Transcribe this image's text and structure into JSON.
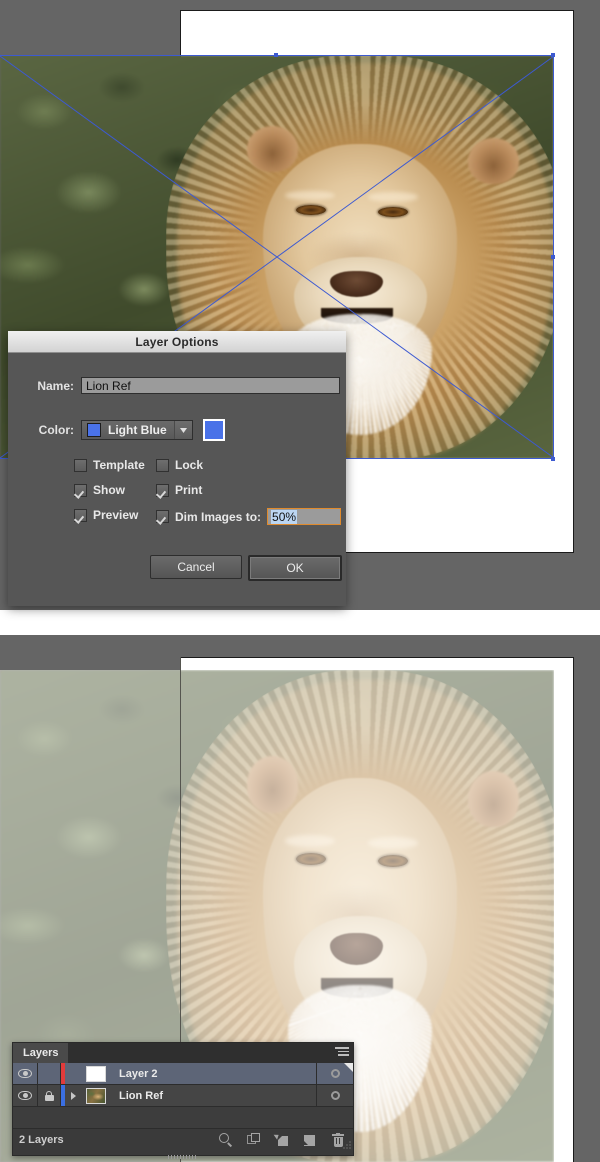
{
  "app": {
    "scene_description": "Adobe Illustrator Layer Options dialog and Layers panel over a lion reference photo"
  },
  "dialog": {
    "title": "Layer Options",
    "name_label": "Name:",
    "name_value": "Lion Ref",
    "color_label": "Color:",
    "color_name": "Light Blue",
    "color_hex": "#4a72e8",
    "color_swatch_hex": "#4a72e8",
    "dropdown_arrow_icon": "chevron-down-icon",
    "checkboxes": [
      {
        "id": "template",
        "label": "Template",
        "checked": false
      },
      {
        "id": "lock",
        "label": "Lock",
        "checked": false
      },
      {
        "id": "show",
        "label": "Show",
        "checked": true
      },
      {
        "id": "print",
        "label": "Print",
        "checked": true
      },
      {
        "id": "preview",
        "label": "Preview",
        "checked": true
      },
      {
        "id": "dim",
        "label": "Dim Images to:",
        "checked": true
      }
    ],
    "dim_value": "50%",
    "cancel_label": "Cancel",
    "ok_label": "OK"
  },
  "layers_panel": {
    "tab_label": "Layers",
    "menu_icon": "panel-menu-icon",
    "rows": [
      {
        "name": "Layer 2",
        "visible": true,
        "visibility_icon": "eye-icon",
        "locked": false,
        "color_hex": "#e23b3b",
        "thumbnail": "blank",
        "expandable": false,
        "selected": true,
        "target_icon": "target-circle-icon"
      },
      {
        "name": "Lion Ref",
        "visible": true,
        "visibility_icon": "eye-icon",
        "locked": true,
        "lock_icon": "lock-icon",
        "color_hex": "#3b6fe2",
        "thumbnail": "image",
        "expandable": true,
        "disclosure_icon": "disclosure-triangle-icon",
        "selected": false,
        "target_icon": "target-circle-icon"
      }
    ],
    "footer_count": "2 Layers",
    "footer_icons": [
      {
        "id": "locate",
        "name": "locate-object-icon"
      },
      {
        "id": "mask",
        "name": "make-clipping-mask-icon"
      },
      {
        "id": "sublayer",
        "name": "create-new-sublayer-icon"
      },
      {
        "id": "newlayer",
        "name": "create-new-layer-icon"
      },
      {
        "id": "delete",
        "name": "delete-selection-icon"
      }
    ],
    "resize_grip_icon": "resize-grip-icon"
  },
  "canvas": {
    "top": {
      "artboard_fill": "#ffffff",
      "background": "#656565",
      "selection_color": "#3d5ad1",
      "image_dimmed": false,
      "image_subject": "lion reference photo"
    },
    "bottom": {
      "artboard_fill": "#ffffff",
      "background": "#656565",
      "image_dimmed": true,
      "dim_percent": "50%",
      "image_subject": "lion reference photo"
    }
  }
}
